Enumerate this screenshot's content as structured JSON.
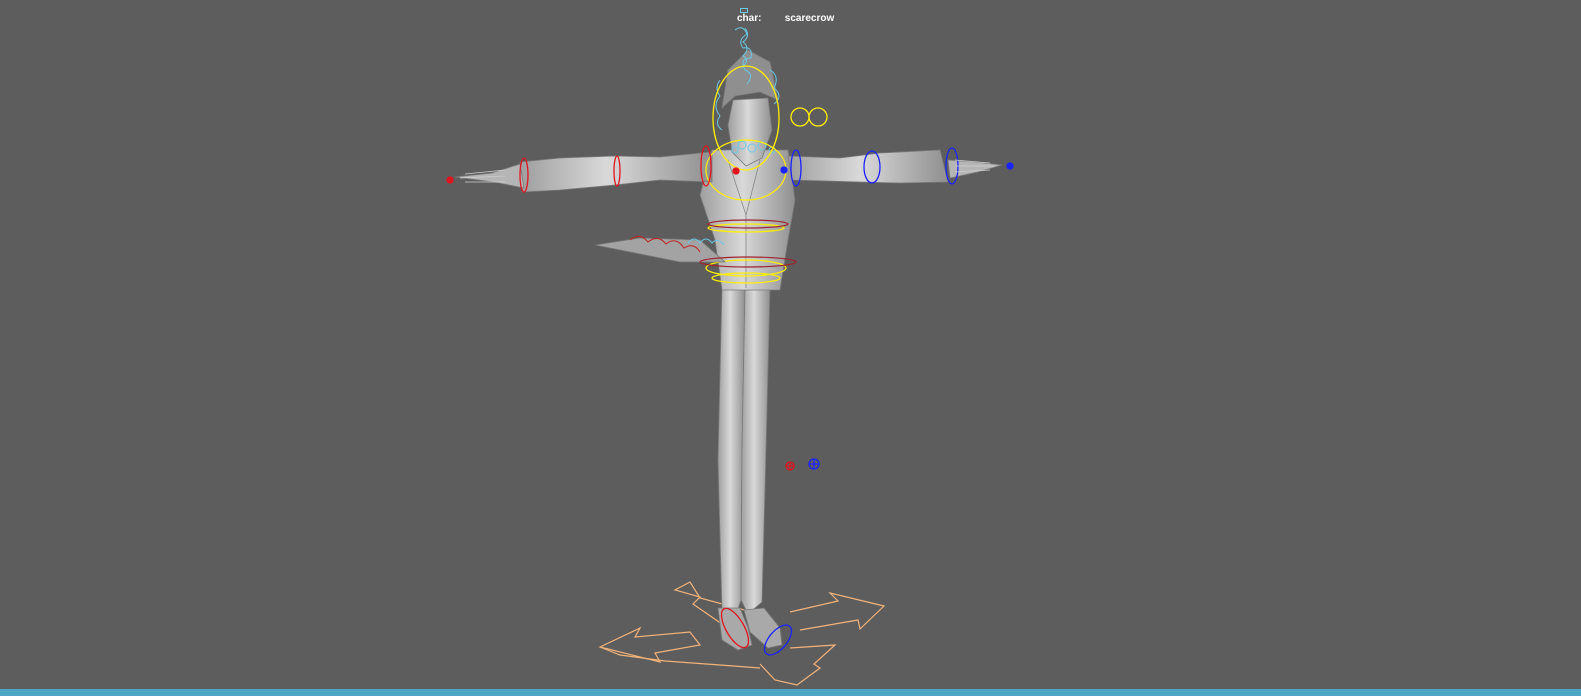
{
  "hud": {
    "char_label": "char:",
    "char_value": "scarecrow"
  },
  "colors": {
    "background": "#5d5d5d",
    "mesh": "#c9c9c9",
    "ctrl_left": "#e0141e",
    "ctrl_right": "#1a22ff",
    "ctrl_center": "#ffee00",
    "ctrl_secondary": "#6cc8e6",
    "ctrl_root": "#f2b27a",
    "timeline_bar": "#4da6c6"
  }
}
